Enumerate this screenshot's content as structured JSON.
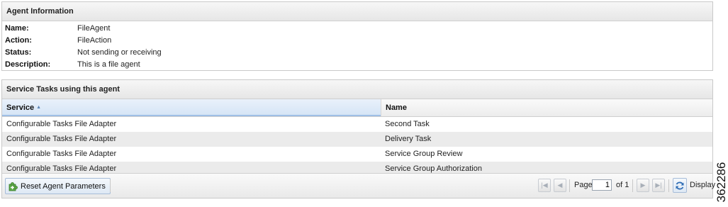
{
  "agent_panel": {
    "title": "Agent Information",
    "fields": [
      {
        "label": "Name:",
        "value": "FileAgent"
      },
      {
        "label": "Action:",
        "value": "FileAction"
      },
      {
        "label": "Status:",
        "value": "Not sending or receiving"
      },
      {
        "label": "Description:",
        "value": "This is a file agent"
      }
    ]
  },
  "tasks_panel": {
    "title": "Service Tasks using this agent",
    "columns": {
      "service": "Service",
      "name": "Name",
      "sort_icon": "sort-ascending-icon"
    },
    "rows": [
      {
        "service": "Configurable Tasks File Adapter",
        "name": "Second Task"
      },
      {
        "service": "Configurable Tasks File Adapter",
        "name": "Delivery Task"
      },
      {
        "service": "Configurable Tasks File Adapter",
        "name": "Service Group Review"
      },
      {
        "service": "Configurable Tasks File Adapter",
        "name": "Service Group Authorization"
      }
    ]
  },
  "toolbar": {
    "reset_label": "Reset Agent Parameters",
    "reset_icon": "puzzle-plus-icon",
    "page_label": "Page",
    "page_value": "1",
    "page_of": "of 1",
    "display_label": "Display",
    "icons": [
      "first-page-icon",
      "prev-page-icon",
      "next-page-icon",
      "last-page-icon",
      "refresh-icon"
    ]
  },
  "figure_id": "362286",
  "colors": {
    "accent": "#9fbfe6",
    "header_bg": "#e6e6e6",
    "alt_row": "#ebebeb"
  }
}
